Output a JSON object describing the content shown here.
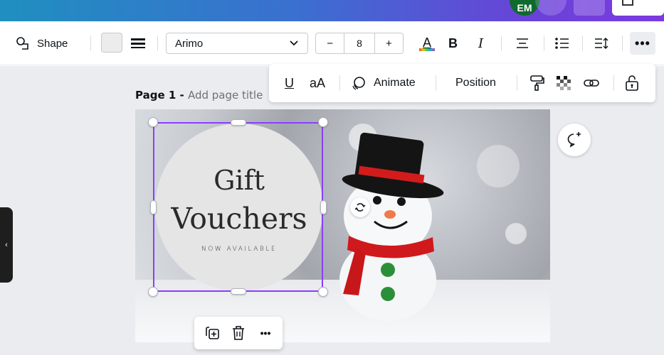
{
  "topbar": {
    "avatar_text": "EM"
  },
  "toolbar": {
    "shape_label": "Shape",
    "font_name": "Arimo",
    "font_size": "8",
    "minus": "−",
    "plus": "+",
    "color_letter": "A",
    "bold_letter": "B",
    "italic_letter": "I",
    "more": "•••"
  },
  "subtoolbar": {
    "underline_letter": "U",
    "case_label": "aA",
    "animate_label": "Animate",
    "position_label": "Position"
  },
  "page": {
    "title_prefix": "Page 1 - ",
    "title_placeholder": "Add page title"
  },
  "design": {
    "line1": "Gift",
    "line2": "Vouchers",
    "line3": "NOW AVAILABLE"
  },
  "floatbar": {
    "more": "•••"
  },
  "side_tab": {
    "glyph": "‹"
  },
  "colors": {
    "selection": "#8b3dff",
    "accent_gradient_start": "#1f8fc0",
    "accent_gradient_end": "#7b3ae0"
  }
}
